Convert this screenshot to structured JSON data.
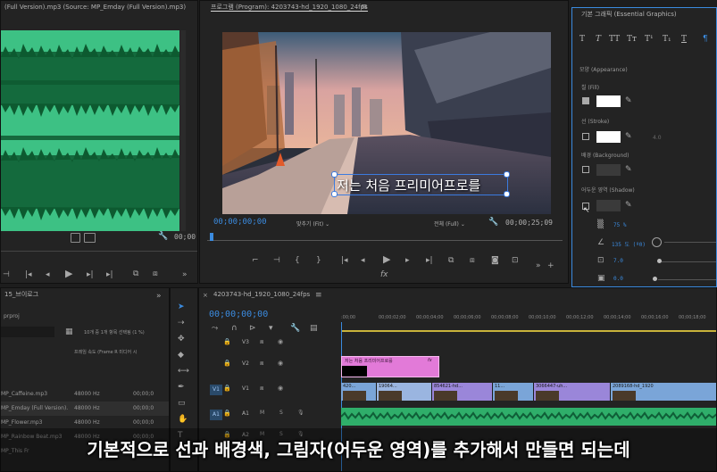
{
  "source": {
    "title": "(Full Version).mp3 (Source: MP_Emday (Full Version).mp3)",
    "timecode": "00;00"
  },
  "program": {
    "title": "프로그램 (Program): 4203743-hd_1920_1080_24fps",
    "caption_text": "저는 처음 프리미어프로를",
    "timecode_current": "00;00;00;00",
    "fit_label": "맞추기 (Fit)",
    "full_label": "전체 (Full)",
    "timecode_duration": "00;00;25;09"
  },
  "essential_graphics": {
    "title": "기본 그래픽 (Essential Graphics)",
    "appearance_label": "모양 (Appearance)",
    "fill_label": "칠 (Fill)",
    "stroke_label": "선 (Stroke)",
    "background_label": "배경 (Background)",
    "shadow_label": "어두운 영역 (Shadow)",
    "stroke_value": "4.0",
    "opacity_value": "75 %",
    "angle_value": "135 도 (º0)",
    "distance_value": "7.0",
    "size_value": "0.0",
    "blur_value": "0.0",
    "text_style_icons": [
      "bold-icon",
      "italic-icon",
      "all-caps-icon",
      "small-caps-icon",
      "superscript-icon",
      "subscript-icon",
      "underline-icon"
    ],
    "fill_color": "#ffffff",
    "stroke_color": "#ffffff",
    "background_color": "#3a3a3a",
    "shadow_color": "#3a3a3a"
  },
  "project": {
    "title": "15_브이로그",
    "file_name": "prproj",
    "selection_info": "10개 중 1개 항목 선택됨 (1 %)",
    "frame_rate_header": "프레임 속도 (Frame R   미디어 시",
    "files": [
      {
        "name": "MP_Caffeine.mp3",
        "rate": "48000 Hz",
        "dur": "00;00;0"
      },
      {
        "name": "MP_Emday (Full Version).",
        "rate": "48000 Hz",
        "dur": "00;00;0"
      },
      {
        "name": "MP_Flower.mp3",
        "rate": "48000 Hz",
        "dur": "00;00;0"
      },
      {
        "name": "MP_Rainbow Beat.mp3",
        "rate": "48000 Hz",
        "dur": "00;00;0"
      },
      {
        "name": "MP_This Fr",
        "rate": "",
        "dur": ""
      }
    ]
  },
  "timeline": {
    "sequence_title": "4203743-hd_1920_1080_24fps",
    "timecode": "00;00;00;00",
    "ticks": [
      ":00;00",
      "00;00;02;00",
      "00;00;04;00",
      "00;00;06;00",
      "00;00;08;00",
      "00;00;10;00",
      "00;00;12;00",
      "00;00;14;00",
      "00;00;16;00",
      "00;00;18;00"
    ],
    "tracks": [
      {
        "name": "V3",
        "type": "video"
      },
      {
        "name": "V2",
        "type": "video"
      },
      {
        "name": "V1",
        "type": "video"
      },
      {
        "name": "A1",
        "type": "audio"
      },
      {
        "name": "A2",
        "type": "audio"
      }
    ],
    "title_clip_label": "저는 처음 프리미어프로를",
    "v1_clips": [
      "420...",
      "19064...",
      "854621-hd...",
      "11...",
      "3066447-uh...",
      "2089168-hd_1920"
    ]
  },
  "subtitle": "기본적으로 선과 배경색, 그림자(어두운 영역)를 추가해서 만들면 되는데",
  "colors": {
    "accent_blue": "#3b8bdf",
    "waveform_green": "#34b878",
    "clip_pink": "#e27ad8",
    "clip_blue": "#7aa5d8",
    "clip_purple": "#9a86d9",
    "audio_green": "#2fae6a"
  }
}
